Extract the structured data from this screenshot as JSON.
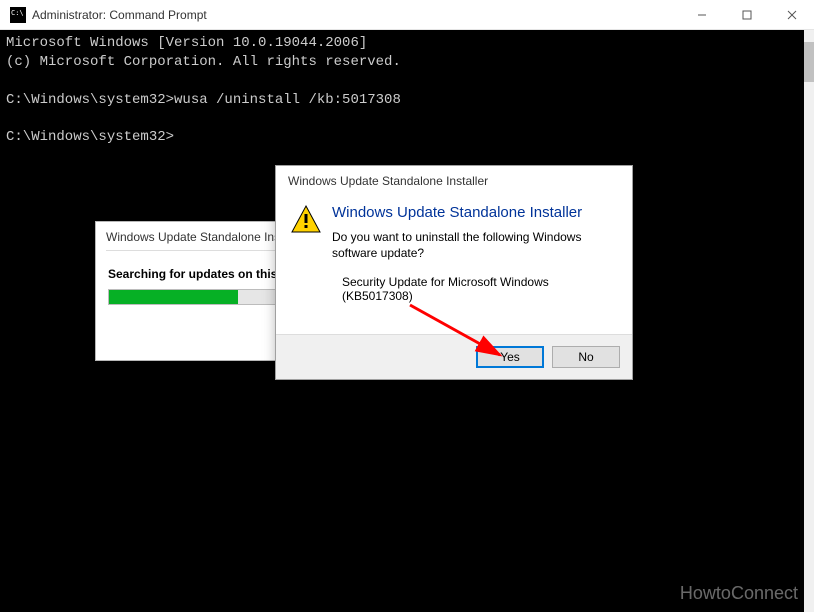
{
  "cmd": {
    "title": "Administrator: Command Prompt",
    "line1": "Microsoft Windows [Version 10.0.19044.2006]",
    "line2": "(c) Microsoft Corporation. All rights reserved.",
    "prompt1": "C:\\Windows\\system32>wusa /uninstall /kb:5017308",
    "prompt2": "C:\\Windows\\system32>"
  },
  "dlg_search": {
    "title": "Windows Update Standalone Installer",
    "status": "Searching for updates on this computer"
  },
  "dlg_confirm": {
    "header": "Windows Update Standalone Installer",
    "heading": "Windows Update Standalone Installer",
    "question": "Do you want to uninstall the following Windows software update?",
    "update_name": "Security Update for Microsoft Windows (KB5017308)",
    "yes": "Yes",
    "no": "No"
  },
  "watermark": "HowtoConnect"
}
